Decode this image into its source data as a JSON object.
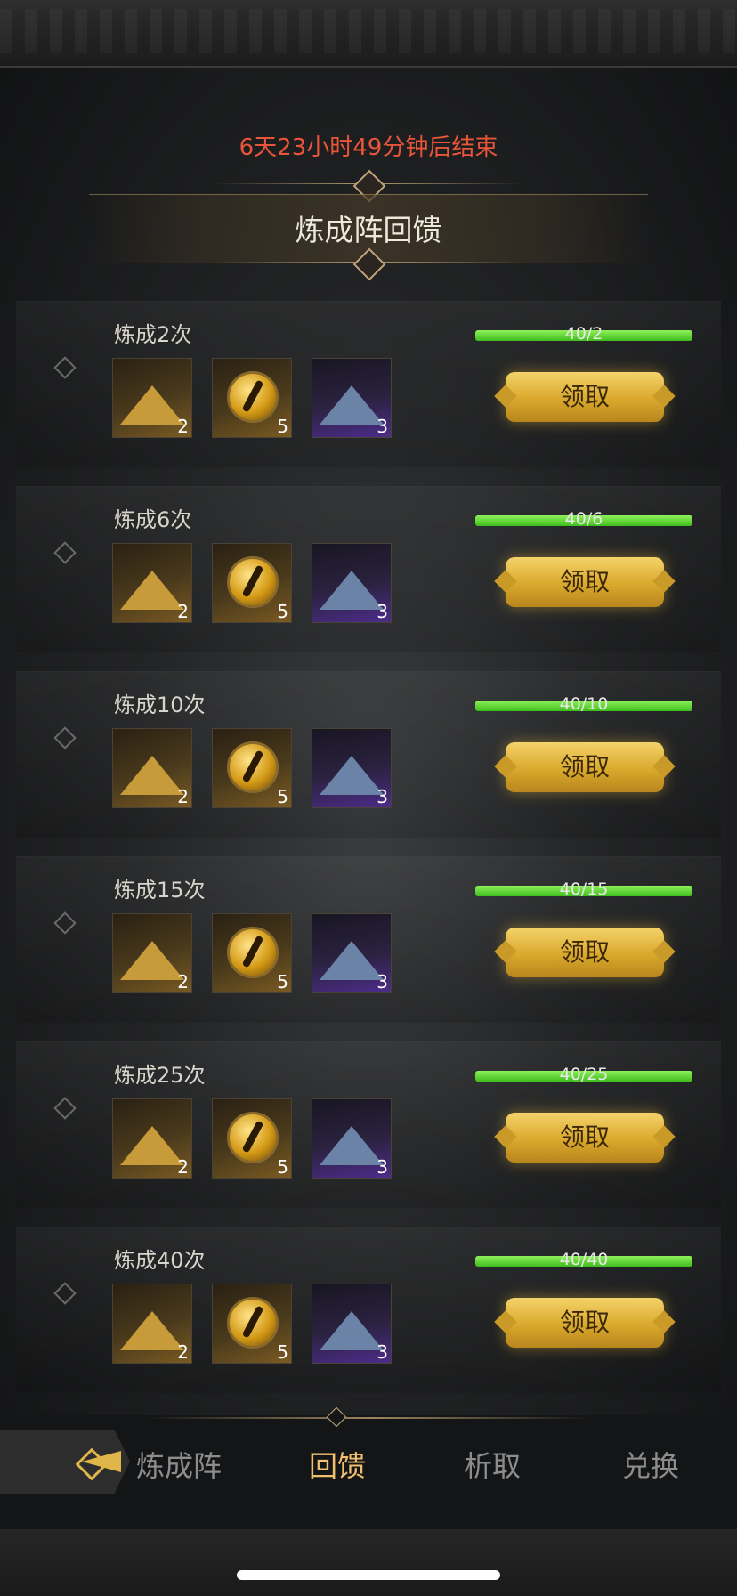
{
  "countdown": "6天23小时49分钟后结束",
  "title": "炼成阵回馈",
  "rows": [
    {
      "label": "炼成2次",
      "progress": "40/2",
      "button": "领取",
      "items": [
        {
          "icon": "gold-pyramid-icon",
          "count": "2"
        },
        {
          "icon": "gold-eye-orb-icon",
          "count": "5"
        },
        {
          "icon": "blue-pyramid-icon",
          "count": "3"
        }
      ]
    },
    {
      "label": "炼成6次",
      "progress": "40/6",
      "button": "领取",
      "items": [
        {
          "icon": "gold-pyramid-icon",
          "count": "2"
        },
        {
          "icon": "gold-eye-orb-icon",
          "count": "5"
        },
        {
          "icon": "blue-pyramid-icon",
          "count": "3"
        }
      ]
    },
    {
      "label": "炼成10次",
      "progress": "40/10",
      "button": "领取",
      "items": [
        {
          "icon": "gold-pyramid-icon",
          "count": "2"
        },
        {
          "icon": "gold-eye-orb-icon",
          "count": "5"
        },
        {
          "icon": "blue-pyramid-icon",
          "count": "3"
        }
      ]
    },
    {
      "label": "炼成15次",
      "progress": "40/15",
      "button": "领取",
      "items": [
        {
          "icon": "gold-pyramid-icon",
          "count": "2"
        },
        {
          "icon": "gold-eye-orb-icon",
          "count": "5"
        },
        {
          "icon": "blue-pyramid-icon",
          "count": "3"
        }
      ]
    },
    {
      "label": "炼成25次",
      "progress": "40/25",
      "button": "领取",
      "items": [
        {
          "icon": "gold-pyramid-icon",
          "count": "2"
        },
        {
          "icon": "gold-eye-orb-icon",
          "count": "5"
        },
        {
          "icon": "blue-pyramid-icon",
          "count": "3"
        }
      ]
    },
    {
      "label": "炼成40次",
      "progress": "40/40",
      "button": "领取",
      "items": [
        {
          "icon": "gold-pyramid-icon",
          "count": "2"
        },
        {
          "icon": "gold-eye-orb-icon",
          "count": "5"
        },
        {
          "icon": "blue-pyramid-icon",
          "count": "3"
        }
      ]
    }
  ],
  "tabs": [
    {
      "label": "炼成阵",
      "active": false
    },
    {
      "label": "回馈",
      "active": true
    },
    {
      "label": "析取",
      "active": false
    },
    {
      "label": "兑换",
      "active": false
    }
  ],
  "colors": {
    "countdown": "#e8553a",
    "progress": "#5fd13a",
    "button": "#e3b23c",
    "active_tab": "#f0c070"
  }
}
